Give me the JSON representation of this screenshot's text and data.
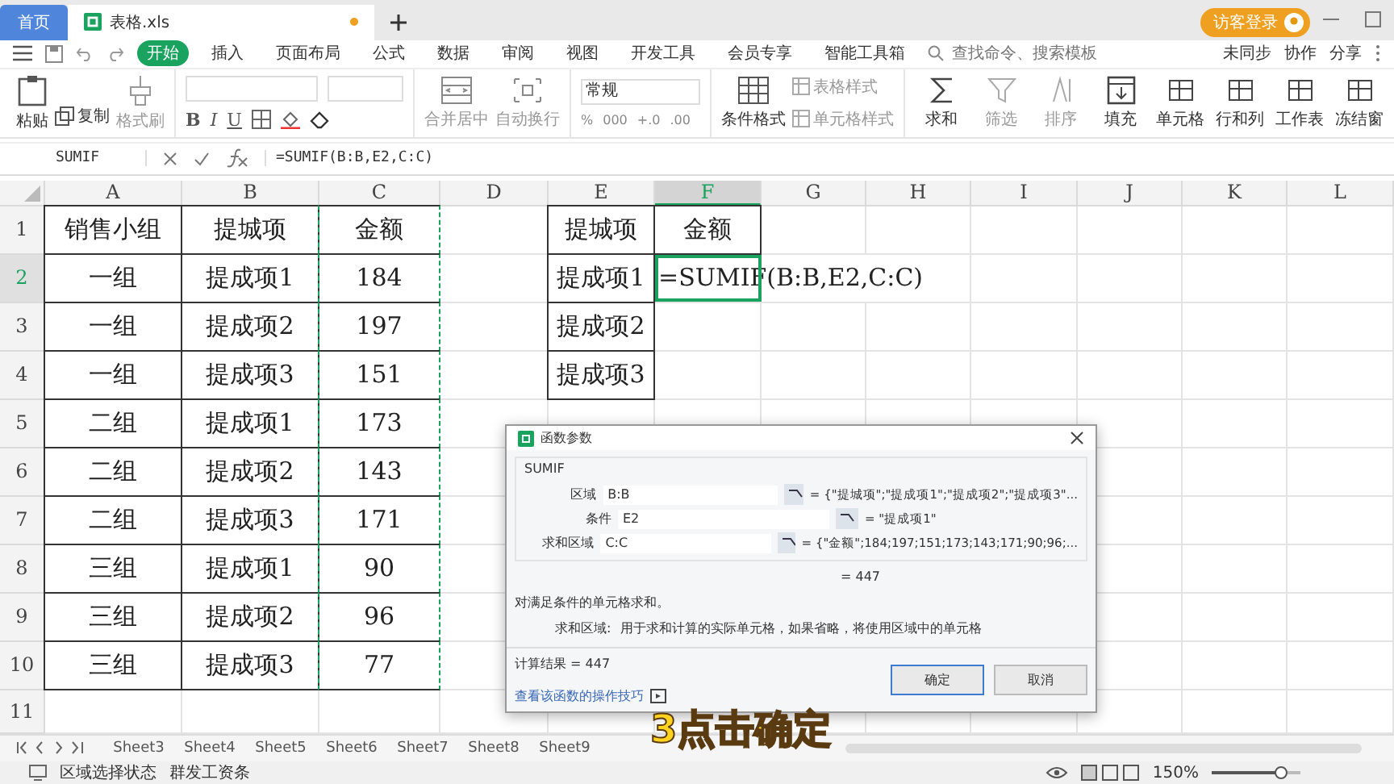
{
  "app_tabs": [
    {
      "label": "首页",
      "selected": false
    },
    {
      "label": "表格.xls",
      "selected": true
    }
  ],
  "login_button": "访客登录",
  "menu_tabs": [
    {
      "label": "开始",
      "selected": true
    },
    {
      "label": "插入",
      "selected": false
    },
    {
      "label": "页面布局",
      "selected": false
    },
    {
      "label": "公式",
      "selected": false
    },
    {
      "label": "数据",
      "selected": false
    },
    {
      "label": "审阅",
      "selected": false
    },
    {
      "label": "视图",
      "selected": false
    },
    {
      "label": "开发工具",
      "selected": false
    },
    {
      "label": "会员专享",
      "selected": false
    },
    {
      "label": "智能工具箱",
      "selected": false
    }
  ],
  "search": {
    "placeholder": "查找命令、搜索模板"
  },
  "menu_actions": [
    "未同步",
    "协作",
    "分享"
  ],
  "ribbon": {
    "paste": {
      "label": "粘贴",
      "disabled": false
    },
    "copy": {
      "label": "复制",
      "disabled": false
    },
    "format_painter": {
      "label": "格式刷",
      "disabled": true
    },
    "font_styles": [
      "B",
      "I",
      "U"
    ],
    "merge": {
      "label": "合并居中",
      "disabled": true
    },
    "wrap": {
      "label": "自动换行",
      "disabled": true
    },
    "number_format": "常规",
    "number_buttons": [
      "%",
      "000",
      "+.0",
      ".00"
    ],
    "style_buttons": [
      {
        "label": "条件格式",
        "disabled": false
      },
      {
        "label": "表格样式",
        "disabled": true
      },
      {
        "label": "单元格样式",
        "disabled": true
      }
    ],
    "large_buttons": [
      {
        "label": "求和",
        "disabled": false
      },
      {
        "label": "筛选",
        "disabled": true
      },
      {
        "label": "排序",
        "disabled": true
      },
      {
        "label": "填充",
        "disabled": false
      },
      {
        "label": "单元格",
        "disabled": false
      },
      {
        "label": "行和列",
        "disabled": false
      },
      {
        "label": "工作表",
        "disabled": false
      },
      {
        "label": "冻结窗",
        "disabled": false
      }
    ]
  },
  "formula_bar": {
    "name_box": "SUMIF",
    "formula": "=SUMIF(B:B,E2,C:C)"
  },
  "columns": [
    {
      "label": "A",
      "selected": false
    },
    {
      "label": "B",
      "selected": false
    },
    {
      "label": "C",
      "selected": false
    },
    {
      "label": "D",
      "selected": false
    },
    {
      "label": "E",
      "selected": false
    },
    {
      "label": "F",
      "selected": true
    },
    {
      "label": "G",
      "selected": false
    },
    {
      "label": "H",
      "selected": false
    },
    {
      "label": "I",
      "selected": false
    },
    {
      "label": "J",
      "selected": false
    },
    {
      "label": "K",
      "selected": false
    },
    {
      "label": "L",
      "selected": false
    }
  ],
  "row_headers": [
    {
      "label": "1",
      "selected": false
    },
    {
      "label": "2",
      "selected": true
    },
    {
      "label": "3",
      "selected": false
    },
    {
      "label": "4",
      "selected": false
    },
    {
      "label": "5",
      "selected": false
    },
    {
      "label": "6",
      "selected": false
    },
    {
      "label": "7",
      "selected": false
    },
    {
      "label": "8",
      "selected": false
    },
    {
      "label": "9",
      "selected": false
    },
    {
      "label": "10",
      "selected": false
    },
    {
      "label": "11",
      "selected": false
    }
  ],
  "left_table": {
    "copied_columns": [
      false,
      false,
      true
    ],
    "rows": [
      [
        "销售小组",
        "提城项",
        "金额"
      ],
      [
        "一组",
        "提成项1",
        "184"
      ],
      [
        "一组",
        "提成项2",
        "197"
      ],
      [
        "一组",
        "提成项3",
        "151"
      ],
      [
        "二组",
        "提成项1",
        "173"
      ],
      [
        "二组",
        "提成项2",
        "143"
      ],
      [
        "二组",
        "提成项3",
        "171"
      ],
      [
        "三组",
        "提成项1",
        "90"
      ],
      [
        "三组",
        "提成项2",
        "96"
      ],
      [
        "三组",
        "提成项3",
        "77"
      ]
    ]
  },
  "right_table": {
    "rows": [
      {
        "cells": [
          "提城项",
          "金额"
        ]
      },
      {
        "cells": [
          "提成项1"
        ],
        "editing": "=SUMIF(B:B,E2,C:C)"
      },
      {
        "cells": [
          "提成项2"
        ]
      },
      {
        "cells": [
          "提成项3"
        ]
      }
    ]
  },
  "dialog": {
    "title": "函数参数",
    "function": "SUMIF",
    "args": [
      {
        "label": "区域",
        "value": "B:B",
        "result": "= {\"提城项\";\"提成项1\";\"提成项2\";\"提成项3\"..."
      },
      {
        "label": "条件",
        "value": "E2",
        "result": "= \"提成项1\""
      },
      {
        "label": "求和区域",
        "value": "C:C",
        "result": "= {\"金额\";184;197;151;173;143;171;90;96;..."
      }
    ],
    "total": "= 447",
    "description": "对满足条件的单元格求和。",
    "help_label": "求和区域:",
    "help_text": "用于求和计算的实际单元格，如果省略，将使用区域中的单元格",
    "result": "计算结果 = 447",
    "link": "查看该函数的操作技巧",
    "buttons": [
      {
        "label": "确定",
        "selected": true
      },
      {
        "label": "取消",
        "selected": false
      }
    ]
  },
  "caption": "3点击确定",
  "sheet_tabs": [
    "Sheet3",
    "Sheet4",
    "Sheet5",
    "Sheet6",
    "Sheet7",
    "Sheet8",
    "Sheet9"
  ],
  "status_bar": {
    "items": [
      "区域选择状态",
      "群发工资条"
    ],
    "zoom": "150%",
    "zoom_slider": {
      "level": 0.8
    }
  }
}
